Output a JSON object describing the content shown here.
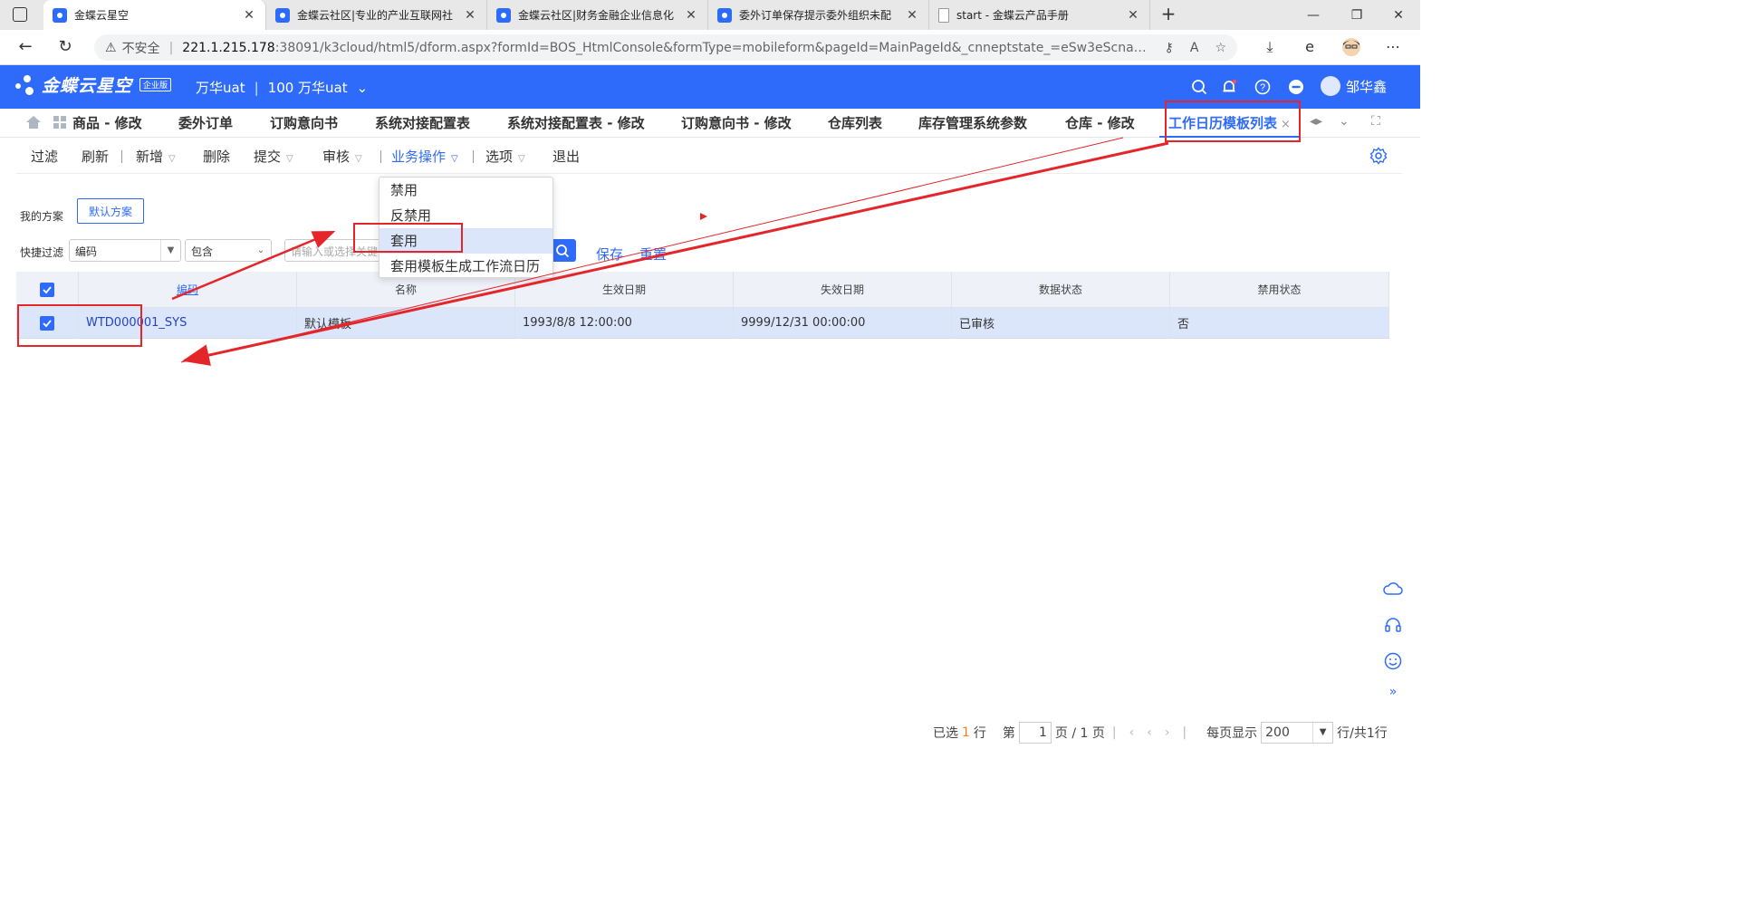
{
  "browser": {
    "tabs": [
      {
        "title": "金蝶云星空",
        "icon": "kingdee-favicon",
        "active": true
      },
      {
        "title": "金蝶云社区|专业的产业互联网社",
        "icon": "kingdee-favicon",
        "active": false
      },
      {
        "title": "金蝶云社区|财务金融企业信息化",
        "icon": "kingdee-favicon",
        "active": false
      },
      {
        "title": "委外订单保存提示委外组织未配",
        "icon": "kingdee-favicon",
        "active": false
      },
      {
        "title": "start - 金蝶云产品手册",
        "icon": "document-favicon",
        "active": false
      }
    ],
    "insecure_label": "不安全",
    "url_host": "221.1.215.178",
    "url_path": ":38091/k3cloud/html5/dform.aspx?formId=BOS_HtmlConsole&formType=mobileform&pageId=MainPageId&_cnneptstate_=eSw3eScnaml5JycveScnV..."
  },
  "app": {
    "brand": "金蝶云星空",
    "edition": "企业版",
    "org_name": "万华uat",
    "org_separator": "|",
    "org_account": "100 万华uat",
    "user_name": "邹华鑫"
  },
  "page_tabs": [
    {
      "label": "商品 - 修改",
      "active": false
    },
    {
      "label": "委外订单",
      "active": false
    },
    {
      "label": "订购意向书",
      "active": false
    },
    {
      "label": "系统对接配置表",
      "active": false
    },
    {
      "label": "系统对接配置表 - 修改",
      "active": false
    },
    {
      "label": "订购意向书 - 修改",
      "active": false
    },
    {
      "label": "仓库列表",
      "active": false
    },
    {
      "label": "库存管理系统参数",
      "active": false
    },
    {
      "label": "仓库 - 修改",
      "active": false
    },
    {
      "label": "工作日历模板列表",
      "active": true
    }
  ],
  "toolbar": {
    "filter": "过滤",
    "refresh": "刷新",
    "add": "新增",
    "delete": "删除",
    "submit": "提交",
    "audit": "审核",
    "business_ops": "业务操作",
    "options": "选项",
    "exit": "退出"
  },
  "business_menu": {
    "items": [
      "禁用",
      "反禁用",
      "套用",
      "套用模板生成工作流日历"
    ],
    "highlighted": "套用"
  },
  "filter": {
    "scheme_label": "我的方案",
    "default_scheme": "默认方案",
    "quick_filter_label": "快捷过滤",
    "field_value": "编码",
    "operator_value": "包含",
    "keyword_placeholder": "请输入或选择关键字",
    "save": "保存",
    "reset": "重置"
  },
  "grid": {
    "columns": [
      "编码",
      "名称",
      "生效日期",
      "失效日期",
      "数据状态",
      "禁用状态"
    ],
    "rows": [
      {
        "checked": true,
        "code": "WTD000001_SYS",
        "name": "默认模板",
        "effective": "1993/8/8 12:00:00",
        "expiry": "9999/12/31 00:00:00",
        "data_status": "已审核",
        "disabled": "否"
      }
    ]
  },
  "pager": {
    "selected_prefix": "已选",
    "selected_count": "1",
    "selected_suffix": "行",
    "page_prefix": "第",
    "page_value": "1",
    "page_suffix": "页 / 1 页",
    "per_page_label": "每页显示",
    "per_page_value": "200",
    "total_text": "行/共1行"
  },
  "colors": {
    "brand": "#2f6bfb",
    "annotation": "#e4262b",
    "row_highlight": "#dce6fb",
    "selected_count": "#f58220"
  }
}
